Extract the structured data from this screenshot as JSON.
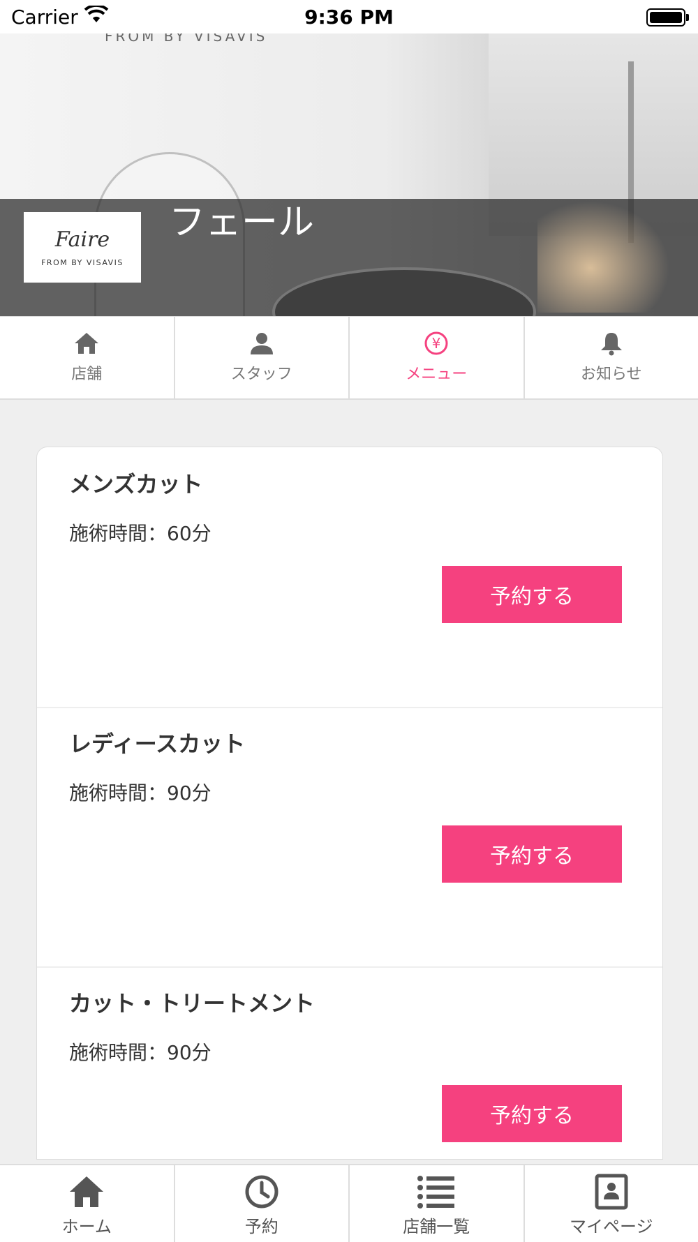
{
  "status_bar": {
    "carrier": "Carrier",
    "time": "9:36 PM"
  },
  "hero": {
    "shop_name": "フェール",
    "logo_script": "Faire",
    "logo_sub": "FROM BY VISAVIS",
    "sign_text": "FROM BY VISAVIS"
  },
  "tabs": [
    {
      "label": "店舗",
      "icon": "home-icon",
      "active": false
    },
    {
      "label": "スタッフ",
      "icon": "user-icon",
      "active": false
    },
    {
      "label": "メニュー",
      "icon": "yen-icon",
      "active": true
    },
    {
      "label": "お知らせ",
      "icon": "bell-icon",
      "active": false
    }
  ],
  "menu_items": [
    {
      "name": "メンズカット",
      "duration": "施術時間：60分",
      "button": "予約する"
    },
    {
      "name": "レディースカット",
      "duration": "施術時間：90分",
      "button": "予約する"
    },
    {
      "name": "カット・トリートメント",
      "duration": "施術時間：90分",
      "button": "予約する"
    }
  ],
  "bottom_nav": [
    {
      "label": "ホーム",
      "icon": "home-icon"
    },
    {
      "label": "予約",
      "icon": "clock-icon"
    },
    {
      "label": "店舗一覧",
      "icon": "list-icon"
    },
    {
      "label": "マイページ",
      "icon": "profile-card-icon"
    }
  ],
  "colors": {
    "accent": "#f5417f",
    "background": "#efefef"
  }
}
